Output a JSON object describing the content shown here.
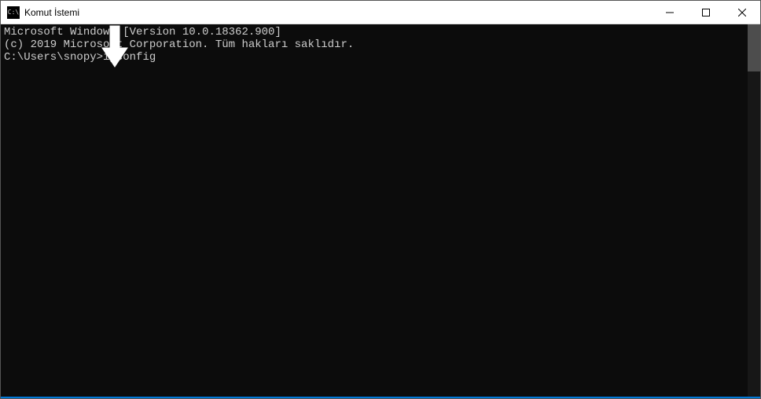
{
  "titlebar": {
    "icon_text": "C:\\",
    "title": "Komut İstemi"
  },
  "terminal": {
    "line1": "Microsoft Windows [Version 10.0.18362.900]",
    "line2": "(c) 2019 Microsoft Corporation. Tüm hakları saklıdır.",
    "blank": "",
    "prompt": "C:\\Users\\snopy>",
    "command": "ipconfig"
  }
}
